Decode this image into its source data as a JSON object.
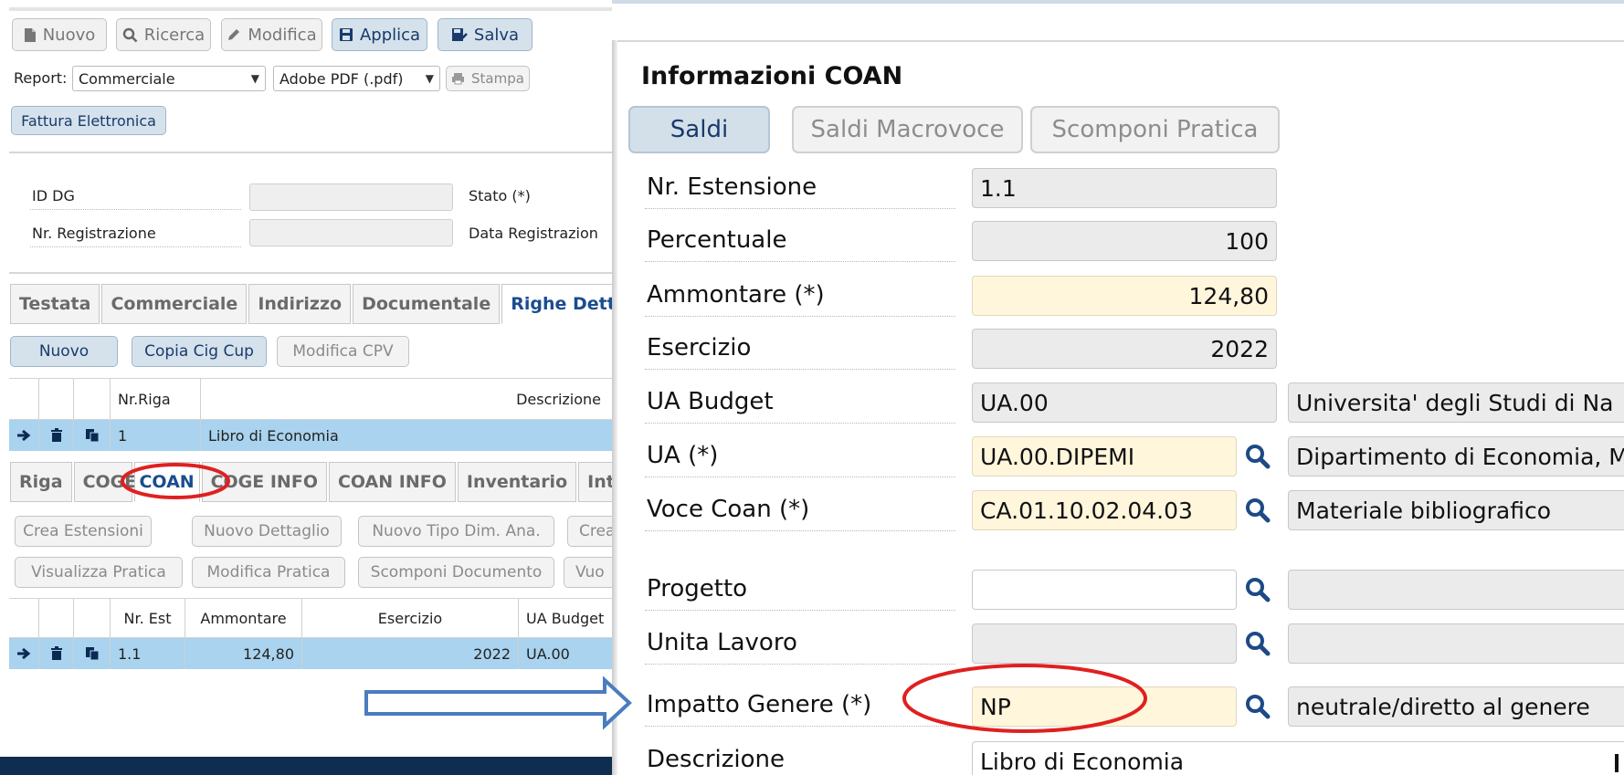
{
  "toolbar": {
    "new": "Nuovo",
    "search": "Ricerca",
    "edit": "Modifica",
    "apply": "Applica",
    "save": "Salva"
  },
  "report": {
    "label": "Report:",
    "type": "Commerciale",
    "format": "Adobe PDF (.pdf)",
    "print": "Stampa"
  },
  "einvoice": "Fattura Elettronica",
  "header_fields": {
    "id_dg": "ID DG",
    "stato": "Stato (*)",
    "nr_registrazione": "Nr. Registrazione",
    "data_registrazione": "Data Registrazion"
  },
  "main_tabs": [
    "Testata",
    "Commerciale",
    "Indirizzo",
    "Documentale",
    "Righe Dettaglio"
  ],
  "detail_buttons": {
    "new": "Nuovo",
    "copy_cig": "Copia Cig Cup",
    "edit_cpv": "Modifica CPV"
  },
  "rows_grid": {
    "headers": [
      "Nr.Riga",
      "Descrizione"
    ],
    "rows": [
      {
        "nr": "1",
        "descrizione": "Libro di Economia"
      }
    ]
  },
  "sub_tabs": [
    "Riga",
    "COGE",
    "COAN",
    "COGE INFO",
    "COAN INFO",
    "Inventario",
    "Intra"
  ],
  "coan_buttons": [
    "Crea Estensioni",
    "Nuovo Dettaglio",
    "Nuovo Tipo Dim. Ana.",
    "Crea",
    "Visualizza Pratica",
    "Modifica Pratica",
    "Scomponi Documento",
    "Vuo"
  ],
  "coan_grid": {
    "headers": [
      "Nr. Est",
      "Ammontare",
      "Esercizio",
      "UA Budget"
    ],
    "rows": [
      {
        "nr_est": "1.1",
        "ammontare": "124,80",
        "esercizio": "2022",
        "ua_budget": "UA.00"
      }
    ]
  },
  "panel": {
    "title": "Informazioni COAN",
    "tabs": [
      "Saldi",
      "Saldi Macrovoce",
      "Scomponi Pratica"
    ],
    "fields": {
      "nr_estensione": {
        "label": "Nr. Estensione",
        "value": "1.1"
      },
      "percentuale": {
        "label": "Percentuale",
        "value": "100"
      },
      "ammontare": {
        "label": "Ammontare (*)",
        "value": "124,80"
      },
      "esercizio": {
        "label": "Esercizio",
        "value": "2022"
      },
      "ua_budget": {
        "label": "UA Budget",
        "value": "UA.00",
        "desc": "Universita' degli Studi di Na"
      },
      "ua": {
        "label": "UA (*)",
        "value": "UA.00.DIPEMI",
        "desc": "Dipartimento di Economia, M"
      },
      "voce_coan": {
        "label": "Voce Coan (*)",
        "value": "CA.01.10.02.04.03",
        "desc": "Materiale bibliografico"
      },
      "progetto": {
        "label": "Progetto",
        "value": "",
        "desc": ""
      },
      "unita_lavoro": {
        "label": "Unita Lavoro",
        "value": "",
        "desc": ""
      },
      "impatto_genere": {
        "label": "Impatto Genere (*)",
        "value": "NP",
        "desc": "neutrale/diretto al genere"
      },
      "descrizione": {
        "label": "Descrizione",
        "value": "Libro di Economia"
      }
    }
  },
  "colors": {
    "accent_blue": "#1a4d8f",
    "row_highlight": "#a9d3ee",
    "required_field": "#fff6dc",
    "annotation_red": "#e02020",
    "annotation_arrow": "#4a7cc0"
  }
}
